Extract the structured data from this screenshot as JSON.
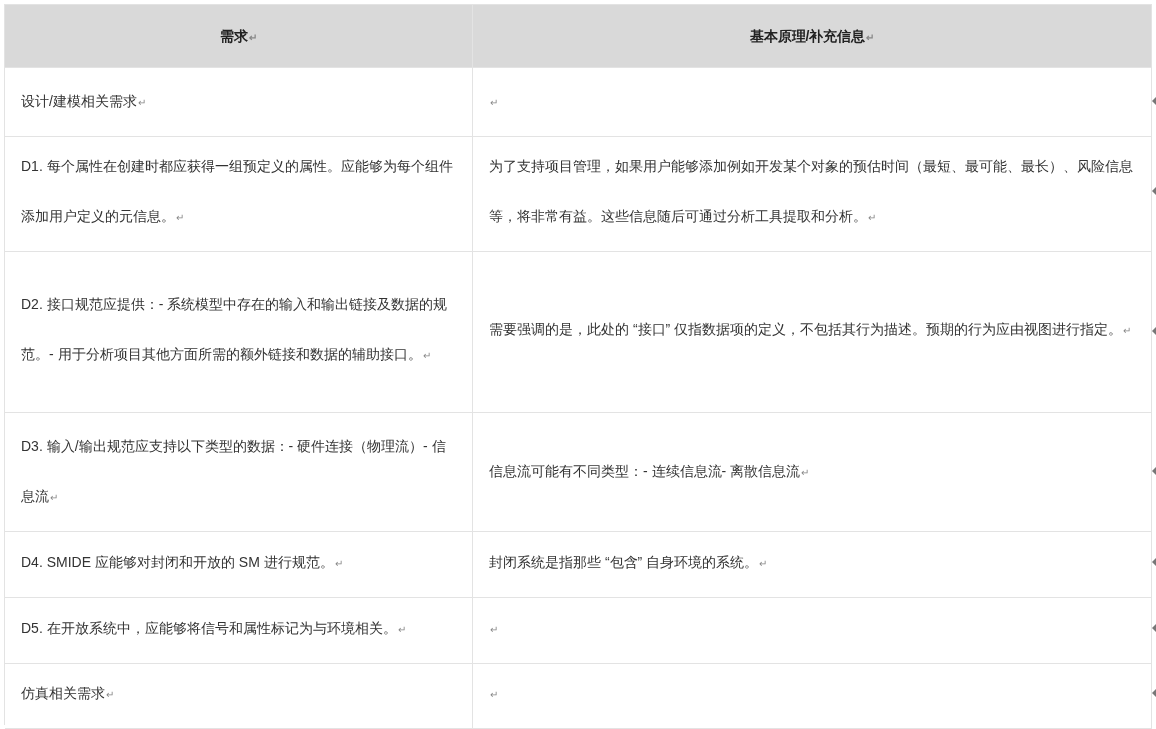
{
  "table": {
    "columns": [
      {
        "text": "需求",
        "mark": "↵"
      },
      {
        "text": "基本原理/补充信息",
        "mark": "↵"
      }
    ],
    "rows": [
      {
        "cells": [
          {
            "text": "设计/建模相关需求",
            "mark": "↵"
          },
          {
            "text": "",
            "mark": "↵"
          }
        ]
      },
      {
        "cells": [
          {
            "text": "D1. 每个属性在创建时都应获得一组预定义的属性。应能够为每个组件添加用户定义的元信息。",
            "mark": "↵"
          },
          {
            "text": "为了支持项目管理，如果用户能够添加例如开发某个对象的预估时间（最短、最可能、最长）、风险信息等，将非常有益。这些信息随后可通过分析工具提取和分析。",
            "mark": "↵"
          }
        ]
      },
      {
        "cells": [
          {
            "text": "D2. 接口规范应提供：- 系统模型中存在的输入和输出链接及数据的规范。- 用于分析项目其他方面所需的额外链接和数据的辅助接口。",
            "mark": "↵"
          },
          {
            "text": "需要强调的是，此处的 “接口” 仅指数据项的定义，不包括其行为描述。预期的行为应由视图进行指定。",
            "mark": "↵"
          }
        ]
      },
      {
        "cells": [
          {
            "text": "D3. 输入/输出规范应支持以下类型的数据：- 硬件连接（物理流）- 信息流",
            "mark": "↵"
          },
          {
            "text": "信息流可能有不同类型：- 连续信息流- 离散信息流",
            "mark": "↵"
          }
        ]
      },
      {
        "cells": [
          {
            "text": "D4. SMIDE 应能够对封闭和开放的 SM 进行规范。",
            "mark": "↵"
          },
          {
            "text": "封闭系统是指那些 “包含” 自身环境的系统。",
            "mark": "↵"
          }
        ]
      },
      {
        "cells": [
          {
            "text": "D5. 在开放系统中，应能够将信号和属性标记为与环境相关。",
            "mark": "↵"
          },
          {
            "text": "",
            "mark": "↵"
          }
        ]
      },
      {
        "cells": [
          {
            "text": "仿真相关需求",
            "mark": "↵"
          },
          {
            "text": "",
            "mark": "↵"
          }
        ]
      }
    ]
  }
}
